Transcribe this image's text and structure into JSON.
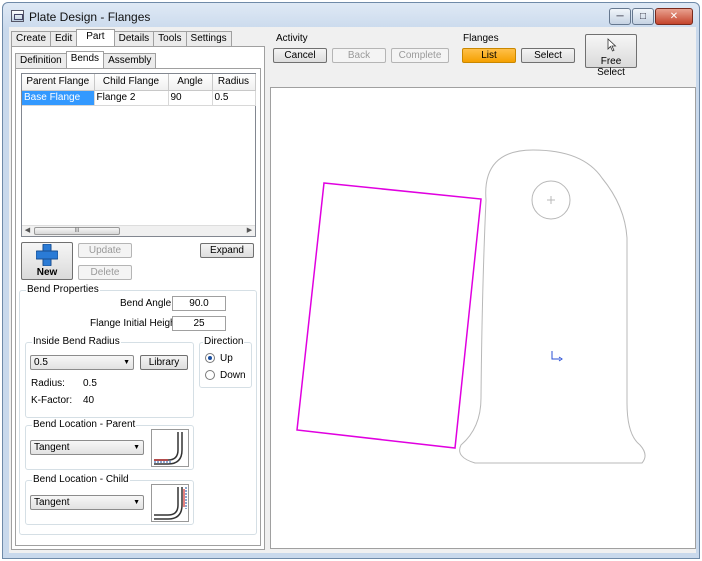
{
  "window": {
    "title": "Plate Design - Flanges"
  },
  "top_tabs": [
    "Create",
    "Edit",
    "Part",
    "Details",
    "Tools",
    "Settings"
  ],
  "sub_tabs": [
    "Definition",
    "Bends",
    "Assembly"
  ],
  "grid": {
    "columns": [
      "Parent Flange",
      "Child Flange",
      "Angle",
      "Radius"
    ],
    "rows": [
      {
        "parent": "Base Flange",
        "child": "Flange 2",
        "angle": "90",
        "radius": "0.5"
      }
    ],
    "scroll_thumb": "III"
  },
  "buttons": {
    "new": "New",
    "update": "Update",
    "delete": "Delete",
    "expand": "Expand",
    "library": "Library"
  },
  "bend_properties": {
    "title": "Bend Properties",
    "bend_angle_label": "Bend Angle:",
    "bend_angle": "90.0",
    "flange_height_label": "Flange Initial Height:",
    "flange_height": "25"
  },
  "inside_radius": {
    "title": "Inside Bend Radius",
    "selected": "0.5",
    "radius_label": "Radius:",
    "radius": "0.5",
    "kfactor_label": "K-Factor:",
    "kfactor": "40"
  },
  "direction": {
    "title": "Direction",
    "up": "Up",
    "down": "Down",
    "selected": "Up"
  },
  "location_parent": {
    "title": "Bend Location - Parent",
    "selected": "Tangent"
  },
  "location_child": {
    "title": "Bend Location - Child",
    "selected": "Tangent"
  },
  "activity": {
    "title": "Activity",
    "cancel": "Cancel",
    "back": "Back",
    "complete": "Complete"
  },
  "flanges": {
    "title": "Flanges",
    "list": "List",
    "select": "Select",
    "free_select": "Free Select"
  },
  "colors": {
    "accent": "#f5a000",
    "selection": "#3399ff",
    "selected_flange": "#e000e0",
    "outline": "#b0b0b0"
  }
}
